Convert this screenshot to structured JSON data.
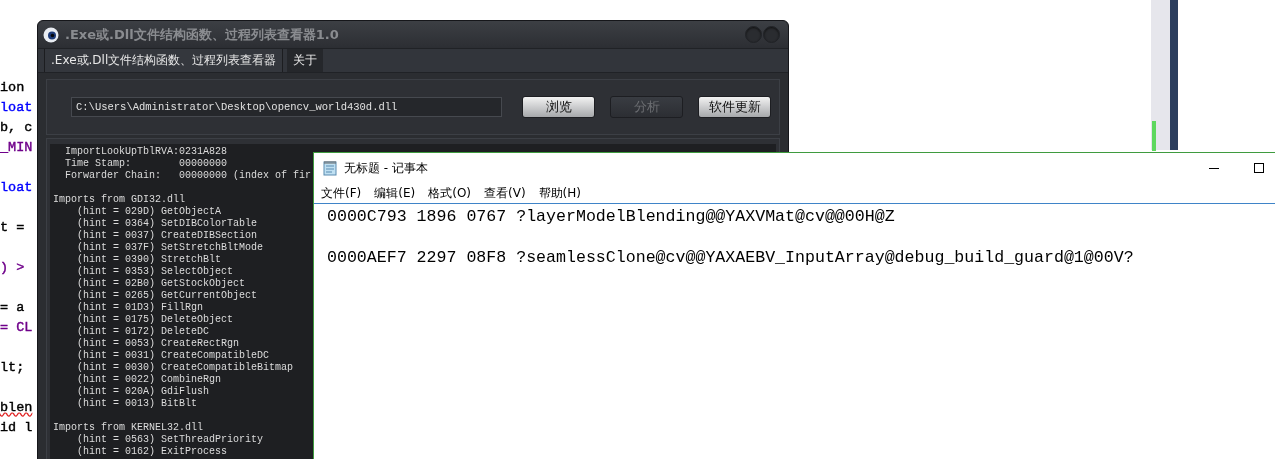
{
  "code_editor": {
    "blocks": [
      {
        "lines": [
          {
            "text": "ion",
            "color": "#000000",
            "error": false
          },
          {
            "text": "loat",
            "color": "#0000ff",
            "error": false
          },
          {
            "text": "b, c",
            "color": "#000000",
            "error": false
          },
          {
            "text": "_MIN",
            "color": "#6f008a",
            "error": false
          }
        ]
      },
      {
        "lines": [
          {
            "text": "loat",
            "color": "#0000ff",
            "error": false
          }
        ]
      },
      {
        "lines": [
          {
            "text": "t =",
            "color": "#000000",
            "error": false
          }
        ]
      },
      {
        "lines": [
          {
            "text": ") >",
            "color": "#6f008a",
            "error": false
          }
        ]
      },
      {
        "lines": [
          {
            "text": "= a",
            "color": "#000000",
            "error": false
          },
          {
            "text": "= CL",
            "color": "#6f008a",
            "error": false
          }
        ]
      },
      {
        "lines": [
          {
            "text": "lt;",
            "color": "#000000",
            "error": false
          }
        ]
      },
      {
        "lines": [
          {
            "text": "blen",
            "color": "#000000",
            "error": true
          },
          {
            "text": "id l",
            "color": "#000000",
            "error": false
          }
        ]
      }
    ]
  },
  "viewer_window": {
    "title": ".Exe或.Dll文件结构函数、过程列表查看器1.0",
    "tabs": [
      {
        "label": ".Exe或.Dll文件结构函数、过程列表查看器",
        "selected": true
      },
      {
        "label": "关于",
        "selected": false
      }
    ],
    "path_field": {
      "value": "C:\\Users\\Administrator\\Desktop\\opencv_world430d.dll"
    },
    "buttons": [
      {
        "label": "浏览",
        "disabled": false
      },
      {
        "label": "分析",
        "disabled": true
      },
      {
        "label": "软件更新",
        "disabled": false
      }
    ],
    "output_sections": [
      {
        "lines": [
          "  ImportLookUpTblRVA:0231A828",
          "  Time Stamp:        00000000",
          "  Forwarder Chain:   00000000 (index of fir"
        ]
      },
      {
        "lines": [
          "Imports from GDI32.dll",
          "    (hint = 029D) GetObjectA",
          "    (hint = 0364) SetDIBColorTable",
          "    (hint = 0037) CreateDIBSection",
          "    (hint = 037F) SetStretchBltMode",
          "    (hint = 0390) StretchBlt",
          "    (hint = 0353) SelectObject",
          "    (hint = 02B0) GetStockObject",
          "    (hint = 0265) GetCurrentObject",
          "    (hint = 01D3) FillRgn",
          "    (hint = 0175) DeleteObject",
          "    (hint = 0172) DeleteDC",
          "    (hint = 0053) CreateRectRgn",
          "    (hint = 0031) CreateCompatibleDC",
          "    (hint = 0030) CreateCompatibleBitmap",
          "    (hint = 0022) CombineRgn",
          "    (hint = 020A) GdiFlush",
          "    (hint = 0013) BitBlt"
        ]
      },
      {
        "lines": [
          "Imports from KERNEL32.dll",
          "    (hint = 0563) SetThreadPriority",
          "    (hint = 0162) ExitProcess"
        ]
      }
    ]
  },
  "notepad": {
    "title": "无标题 - 记事本",
    "menu": [
      "文件(F)",
      "编辑(E)",
      "格式(O)",
      "查看(V)",
      "帮助(H)"
    ],
    "lines": [
      "0000C793 1896 0767 ?layerModelBlending@@YAXVMat@cv@@00H@Z",
      "0000AEF7 2297 08F8 ?seamlessClone@cv@@YAXAEBV_InputArray@debug_build_guard@1@00V?"
    ]
  }
}
